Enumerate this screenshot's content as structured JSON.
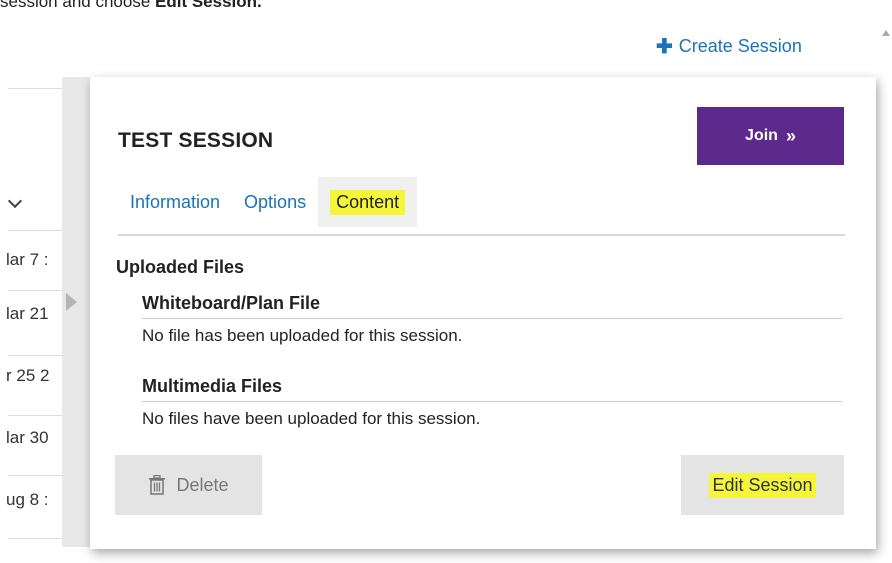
{
  "intro": {
    "prefix": "session and choose ",
    "bold": "Edit Session."
  },
  "header": {
    "create_session_label": "Create Session",
    "create_session_icon": "plus-icon"
  },
  "background_list": {
    "rows": [
      "lar 7 :",
      "lar 21",
      "r 25 2",
      "lar 30",
      "ug 8 :"
    ]
  },
  "session": {
    "title": "TEST SESSION",
    "join_label": "Join",
    "join_icon": "double-chevron-right-icon"
  },
  "tabs": [
    {
      "label": "Information",
      "active": false
    },
    {
      "label": "Options",
      "active": false
    },
    {
      "label": "Content",
      "active": true
    }
  ],
  "content": {
    "section_title": "Uploaded Files",
    "whiteboard": {
      "heading": "Whiteboard/Plan File",
      "message": "No file has been uploaded for this session."
    },
    "multimedia": {
      "heading": "Multimedia Files",
      "message": "No files have been uploaded for this session."
    }
  },
  "actions": {
    "delete_label": "Delete",
    "delete_icon": "trash-icon",
    "edit_label": "Edit Session"
  },
  "colors": {
    "accent_purple": "#5c2a8c",
    "link_blue": "#1a73b5",
    "highlight_yellow": "#f5f53a"
  }
}
